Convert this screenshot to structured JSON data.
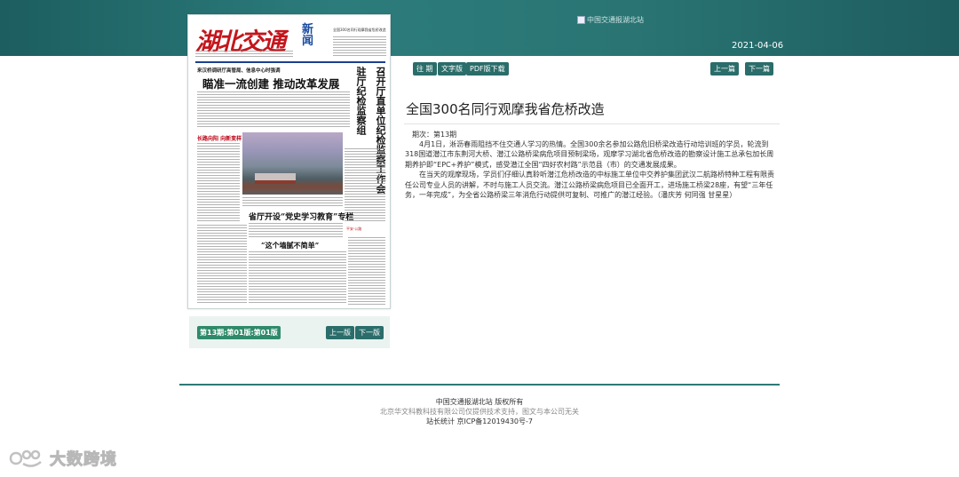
{
  "header": {
    "banner_alt": "中国交通报湖北站",
    "date": "2021-04-06"
  },
  "newspaper_preview": {
    "masthead": "湖北交通",
    "masthead_news": "新闻",
    "top_right": "全国300名同行观摩我省危桥改造",
    "sub_head": "来汉桥调研厅高管局、信息中心时强调",
    "headline": "瞄准一流创建 推动改革发展",
    "column_head_1": "驻厅纪检监察组",
    "column_head_2": "召开厅直单位纪检监察工作会",
    "side_head": "长路向阳 向新变样",
    "mid_head": "省厅开设“党史学习教育”专栏",
    "quote_head": "“这个墙腻不简单”",
    "red_mark": "平安·公路"
  },
  "pager": {
    "issue_badge": "第13期:第01版:第01版",
    "prev": "上一版",
    "next": "下一版"
  },
  "toolbar": {
    "past_issues": "往 期",
    "text_version": "文字版",
    "pdf_download": "PDF版下载",
    "prev_article": "上一篇",
    "next_article": "下一篇"
  },
  "article": {
    "title": "全国300名同行观摩我省危桥改造",
    "issue_line": "期次：第13期",
    "paragraphs": [
      "4月1日，淅沥春雨阻挡不住交通人学习的热情。全国300余名参加公路危旧桥梁改造行动培训班的学员，轮流到318国道潜江市东荆河大桥、潜江公路桥梁病危项目预制梁场，观摩学习湖北省危桥改造的勘察设计施工总承包加长周期养护即“EPC+养护”模式，感受潜江全国“四好农村路”示范县（市）的交通发展成果。",
      "在当天的观摩现场，学员们仔细认真聆听潜江危桥改造的中标施工单位中交养护集团武汉二航路桥特种工程有限责任公司专业人员的讲解，不时与施工人员交流。潜江公路桥梁病危项目已全面开工，进场施工桥梁28座，有望“三年任务，一年完成”，为全省公路桥梁三年消危行动提供可复制、可推广的潜江经验。（潘庆芳 何同强 甘星星）"
    ]
  },
  "footer": {
    "line1": "中国交通报湖北站 版权所有",
    "line2": "北京华文科教科技有限公司仅提供技术支持，图文与本公司无关",
    "line3": "站长统计 京ICP备12019430号-7"
  },
  "watermark": {
    "text": "大数跨境"
  },
  "colors": {
    "header_band": "#2a7574",
    "button": "#2a6d6a",
    "badge": "#2f8a6a",
    "masthead_red": "#c4161c"
  }
}
